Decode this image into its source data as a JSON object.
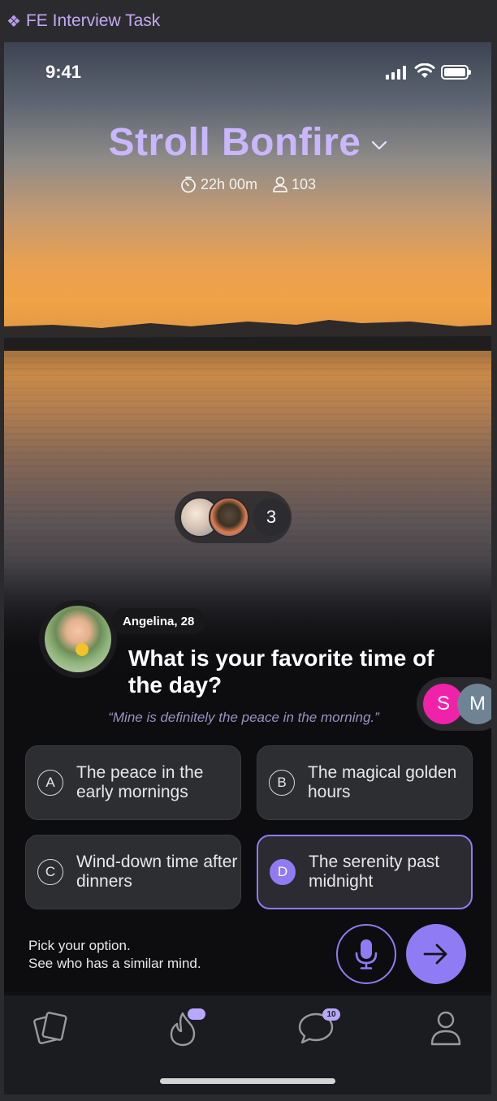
{
  "frame": {
    "label": "FE Interview Task",
    "glyph": "❖"
  },
  "status_bar": {
    "time": "9:41"
  },
  "header": {
    "title": "Stroll Bonfire",
    "timer": "22h 00m",
    "participants": "103"
  },
  "participant_pill": {
    "count": "3"
  },
  "prompt": {
    "author": "Angelina, 28",
    "question": "What is your favorite time of the day?",
    "quote": "“Mine is definitely the peace in the morning.”"
  },
  "side_users": [
    "S",
    "M"
  ],
  "options": [
    {
      "letter": "A",
      "text": "The peace in the early mornings",
      "selected": false
    },
    {
      "letter": "B",
      "text": "The magical golden hours",
      "selected": false
    },
    {
      "letter": "C",
      "text": "Wind-down time after dinners",
      "selected": false
    },
    {
      "letter": "D",
      "text": "The serenity past midnight",
      "selected": true
    }
  ],
  "helper": {
    "line1": "Pick your option.",
    "line2": "See who has a similar mind."
  },
  "tabbar": {
    "messages_badge": "10"
  },
  "icons": [
    "cards-icon",
    "flame-icon",
    "chat-icon",
    "profile-icon",
    "mic-icon",
    "arrow-right-icon",
    "stopwatch-icon",
    "person-icon",
    "chevron-down-icon"
  ],
  "colors": {
    "accent": "#8f7cf5",
    "title": "#c9b6ff",
    "card": "#2c2e31",
    "pink": "#f022a9"
  }
}
